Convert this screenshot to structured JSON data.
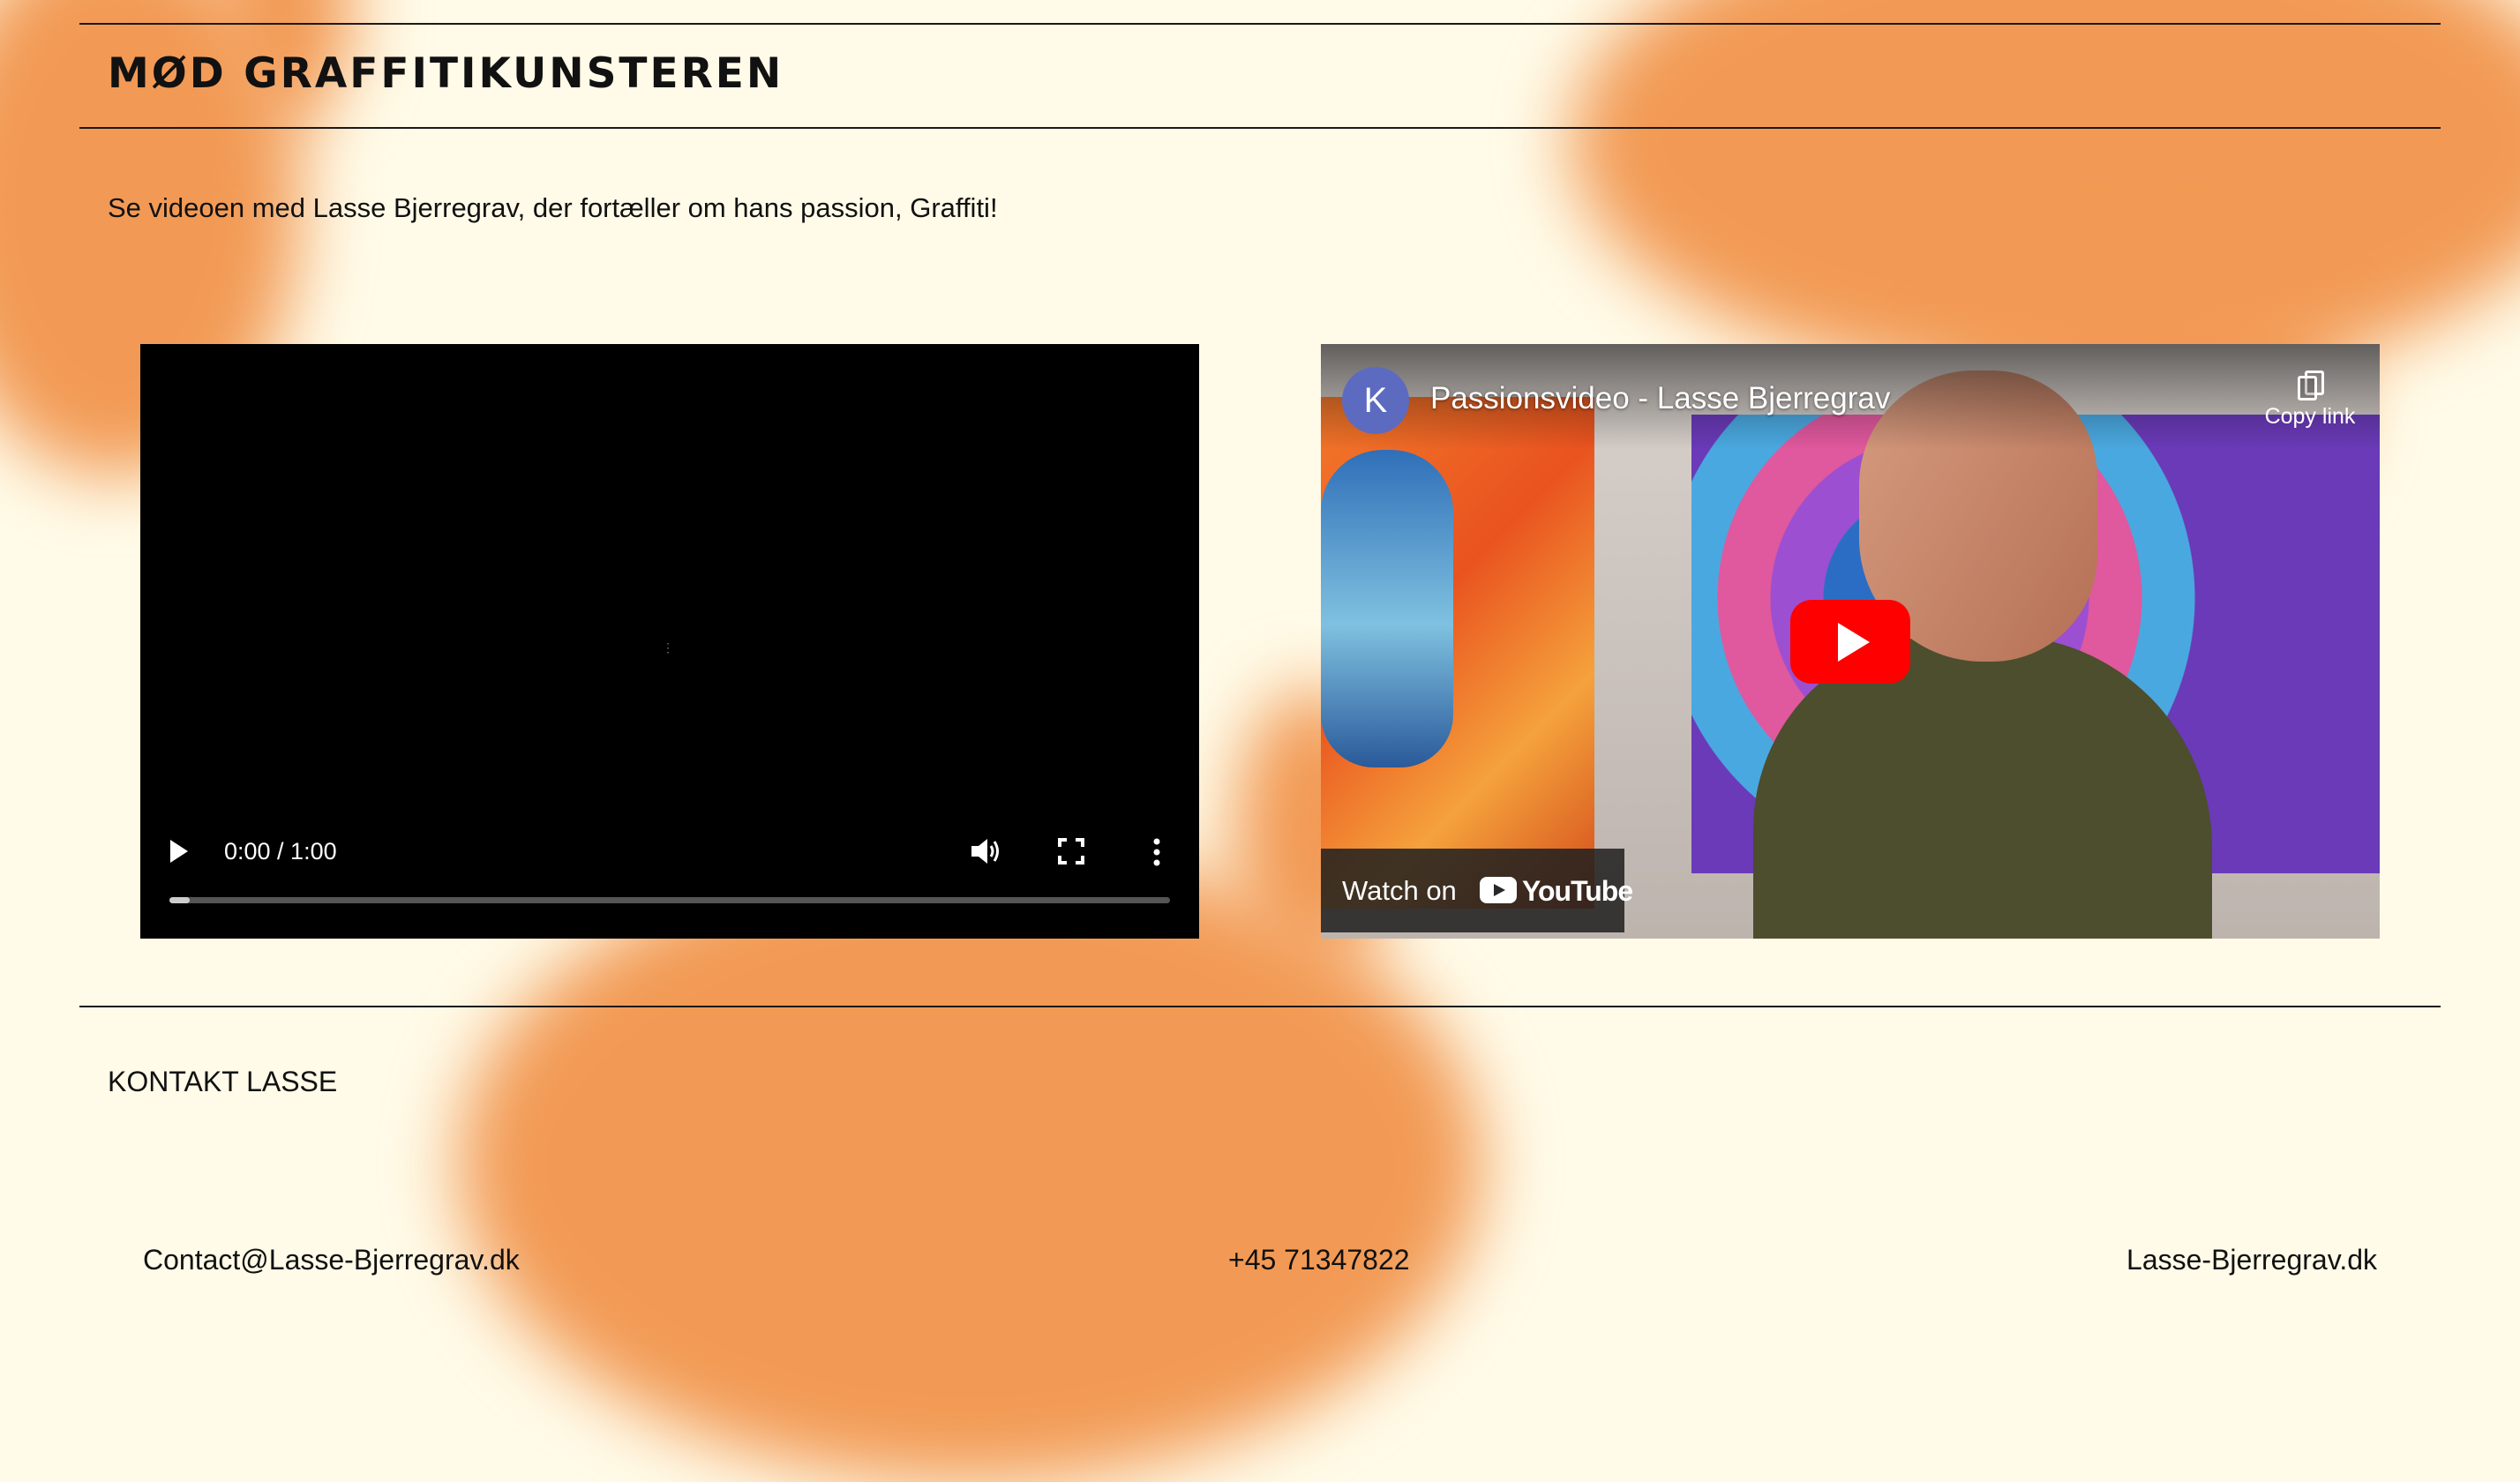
{
  "heading": "MØD GRAFFITIKUNSTEREN",
  "intro": "Se videoen med Lasse Bjerregrav, der fortæller om hans passion, Graffiti!",
  "video_player": {
    "time": "0:00 / 1:00",
    "progress": 0.02
  },
  "youtube_embed": {
    "channel_initial": "K",
    "title": "Passionsvideo - Lasse Bjerregrav",
    "copy_link_label": "Copy link",
    "watch_on_label": "Watch on",
    "brand_label": "YouTube"
  },
  "contact_section": {
    "title": "KONTAKT LASSE",
    "email": "Contact@Lasse-Bjerregrav.dk",
    "phone": "+45 71347822",
    "website": "Lasse-Bjerregrav.dk"
  },
  "colors": {
    "background": "#fffbe8",
    "accent_orange": "#f29a55",
    "youtube_red": "#ff0000"
  }
}
